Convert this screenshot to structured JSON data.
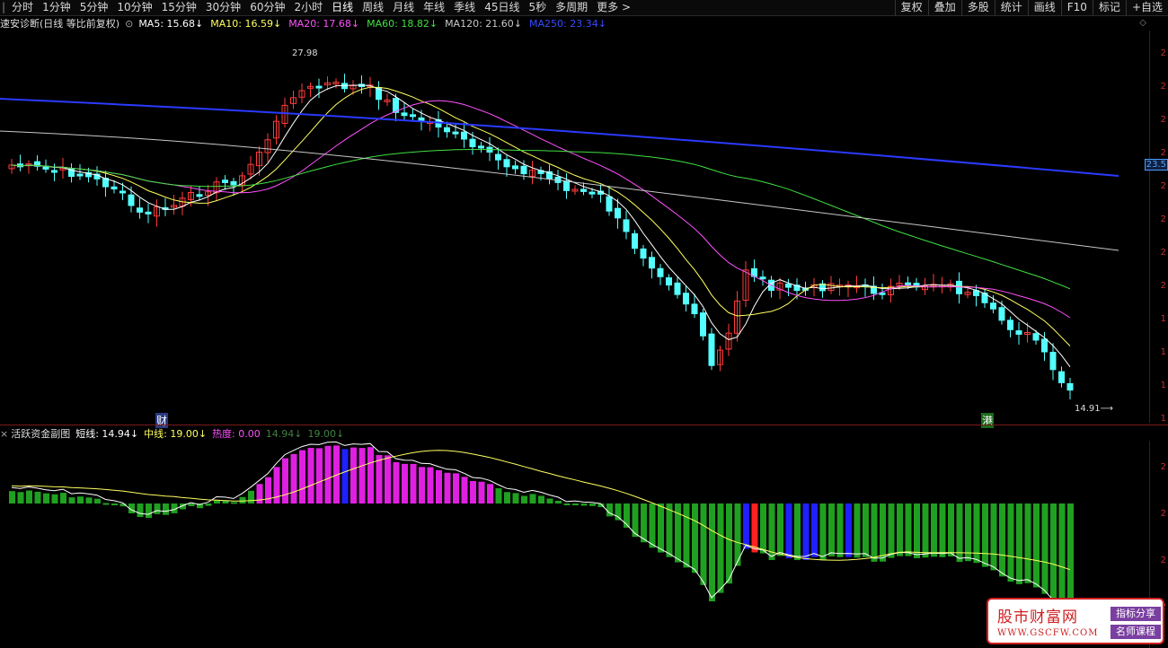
{
  "toolbar": {
    "marker_left": "|",
    "tabs": [
      "分时",
      "1分钟",
      "5分钟",
      "10分钟",
      "15分钟",
      "30分钟",
      "60分钟",
      "2小时",
      "日线",
      "周线",
      "月线",
      "年线",
      "季线",
      "45日线",
      "5秒",
      "多周期",
      "更多 >"
    ],
    "active_tab": "日线",
    "right_tools": [
      "复权",
      "叠加",
      "多股",
      "统计",
      "画线",
      "F10",
      "标记",
      "+自选"
    ]
  },
  "main_info": {
    "title": "速安诊断(日线 等比前复权)",
    "ma5": "MA5: 15.68↓",
    "ma10": "MA10: 16.59↓",
    "ma20": "MA20: 17.68↓",
    "ma60": "MA60: 18.82↓",
    "ma120": "MA120: 21.60↓",
    "ma250": "MA250: 23.34↓"
  },
  "sub_info": {
    "title": "活跃资金副图",
    "short": "短线: 14.94↓",
    "mid": "中线: 19.00↓",
    "heat": "热度: 0.00",
    "v1": "14.94↓",
    "v2": "19.00↓"
  },
  "annotations": {
    "high": "27.98",
    "low": "14.91",
    "cai": "财",
    "gang": "港",
    "price_tag": "23.5"
  },
  "yaxis_labels": [
    "2",
    "2",
    "2",
    "2",
    "2",
    "2",
    "2",
    "2",
    "1",
    "1",
    "1",
    "1"
  ],
  "sub_yaxis_labels": [
    "2",
    "2",
    "2",
    "2"
  ],
  "colors": {
    "up": "#ff3b3b",
    "down": "#54ffff",
    "ma5": "#ffffff",
    "ma10": "#ffff60",
    "ma20": "#ff50ff",
    "ma60": "#40e040",
    "ma120": "#c8c8c8",
    "ma250": "#2a3aff"
  },
  "watermark": {
    "title": "股市财富网",
    "url": "WWW.GSCFW.COM",
    "badge1": "指标分享",
    "badge2": "名师课程"
  }
}
